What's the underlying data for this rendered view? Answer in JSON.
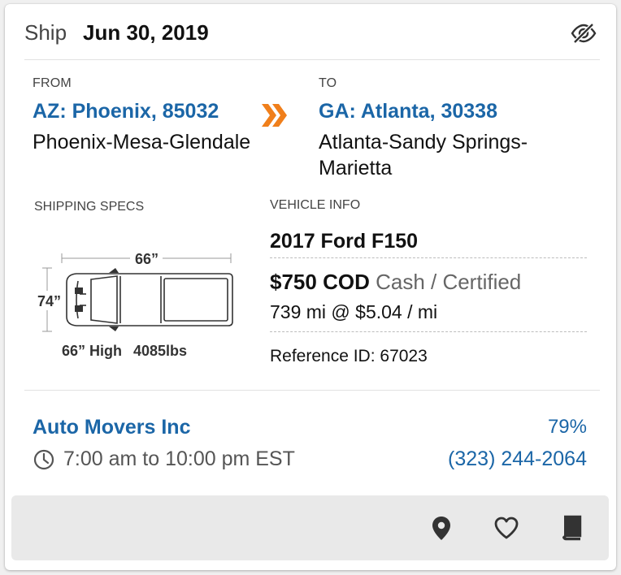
{
  "header": {
    "ship_label": "Ship",
    "ship_date": "Jun 30, 2019",
    "hide_icon": "eye-slash-icon"
  },
  "route": {
    "from_label": "FROM",
    "from_location": "AZ: Phoenix, 85032",
    "from_metro": "Phoenix-Mesa-Glendale",
    "to_label": "TO",
    "to_location": "GA: Atlanta, 30338",
    "to_metro": "Atlanta-Sandy Springs-Marietta",
    "arrow_icon": "double-chevron-right-icon",
    "arrow_color": "#f07f1b"
  },
  "specs": {
    "label": "SHIPPING SPECS",
    "length": "66”",
    "width": "74”",
    "height": "66” High",
    "weight": "4085lbs"
  },
  "vehicle": {
    "label": "VEHICLE INFO",
    "name": "2017 Ford F150",
    "price": "$750 COD",
    "payment_method": "Cash / Certified",
    "rate": "739 mi @ $5.04 / mi",
    "reference": "Reference ID: 67023"
  },
  "company": {
    "name": "Auto Movers Inc",
    "rating": "79%",
    "hours": "7:00 am to 10:00 pm EST",
    "phone": "(323) 244-2064"
  },
  "footer": {
    "icons": [
      "map-pin-icon",
      "heart-icon",
      "book-icon"
    ]
  },
  "colors": {
    "link_blue": "#1b66a7",
    "accent_orange": "#f07f1b"
  }
}
